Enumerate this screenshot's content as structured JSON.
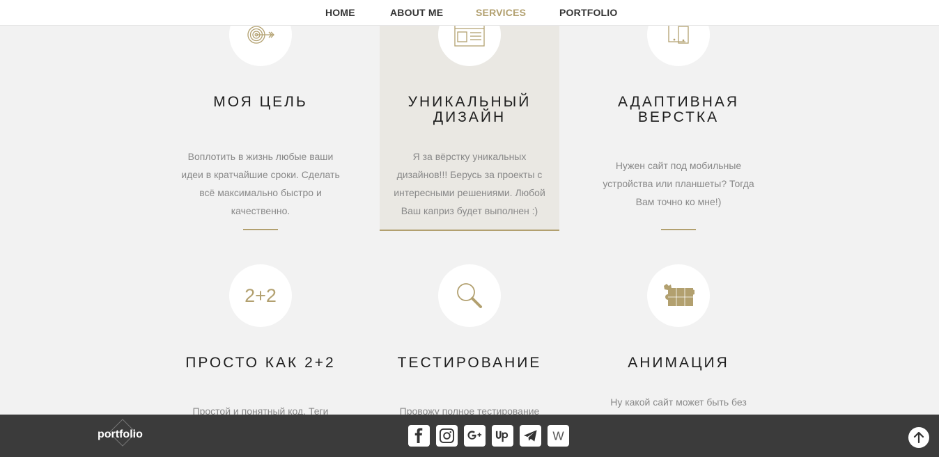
{
  "nav": {
    "items": [
      {
        "label": "HOME"
      },
      {
        "label": "ABOUT ME"
      },
      {
        "label": "SERVICES"
      },
      {
        "label": "PORTFOLIO"
      }
    ],
    "active": "SERVICES"
  },
  "services": [
    {
      "icon": "target-icon",
      "title": "МОЯ ЦЕЛЬ",
      "text": "Воплотить в жизнь любые ваши идеи в кратчайшие сроки. Сделать всё максимально быстро и качественно."
    },
    {
      "icon": "web-layout-icon",
      "title": "УНИКАЛЬНЫЙ ДИЗАЙН",
      "text": "Я за вёрстку уникальных дизайнов!!! Берусь за проекты с интересными решениями. Любой Ваш каприз будет выполнен :)"
    },
    {
      "icon": "devices-icon",
      "title": "АДАПТИВНАЯ ВЕРСТКА",
      "text": "Нужен сайт под мобильные устройства или планшеты? Тогда Вам точно ко мне!)"
    },
    {
      "icon": "two-plus-two-icon",
      "icon_text": "2+2",
      "title": "ПРОСТО КАК 2+2",
      "text": "Простой и понятный код. Теги"
    },
    {
      "icon": "magnifier-icon",
      "title": "ТЕСТИРОВАНИЕ",
      "text": "Провожу полное тестирование"
    },
    {
      "icon": "puzzle-icon",
      "title": "АНИМАЦИЯ",
      "text": "Ну какой сайт может быть без"
    }
  ],
  "footer": {
    "logo": "portfolio",
    "social": [
      {
        "icon": "facebook-icon",
        "label": "f"
      },
      {
        "icon": "instagram-icon",
        "label": ""
      },
      {
        "icon": "google-plus-icon",
        "label": "g+"
      },
      {
        "icon": "upwork-icon",
        "label": "Up"
      },
      {
        "icon": "telegram-icon",
        "label": ""
      },
      {
        "icon": "wiki-icon",
        "label": "W"
      }
    ],
    "up_icon": "arrow-up-icon"
  },
  "colors": {
    "accent": "#b2a06f",
    "background": "#f2f2f2",
    "footer": "#3b3b3b",
    "highlight": "#eae8e3"
  }
}
